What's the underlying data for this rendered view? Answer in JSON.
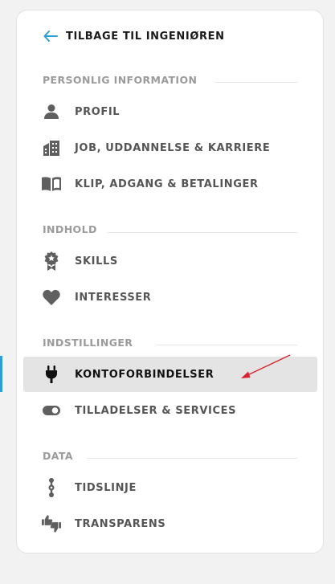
{
  "back_link": {
    "label": "TILBAGE TIL INGENIØREN",
    "icon": "arrow-left-icon",
    "color": "#2b9ed8"
  },
  "sections": [
    {
      "title": "PERSONLIG INFORMATION",
      "items": [
        {
          "label": "PROFIL",
          "icon": "person-icon"
        },
        {
          "label": "JOB, UDDANNELSE & KARRIERE",
          "icon": "building-icon"
        },
        {
          "label": "KLIP, ADGANG & BETALINGER",
          "icon": "book-icon"
        }
      ]
    },
    {
      "title": "INDHOLD",
      "items": [
        {
          "label": "SKILLS",
          "icon": "award-badge-icon"
        },
        {
          "label": "INTERESSER",
          "icon": "heart-icon"
        }
      ]
    },
    {
      "title": "INDSTILLINGER",
      "items": [
        {
          "label": "KONTOFORBINDELSER",
          "icon": "plug-icon",
          "active": true
        },
        {
          "label": "TILLADELSER & SERVICES",
          "icon": "toggle-icon"
        }
      ]
    },
    {
      "title": "DATA",
      "items": [
        {
          "label": "TIDSLINJE",
          "icon": "timeline-icon"
        },
        {
          "label": "TRANSPARENS",
          "icon": "thumbs-up-down-icon"
        }
      ]
    }
  ],
  "colors": {
    "accent": "#2b9ed8",
    "annotation_arrow": "#d9232d",
    "active_bg": "#e4e4e4"
  }
}
